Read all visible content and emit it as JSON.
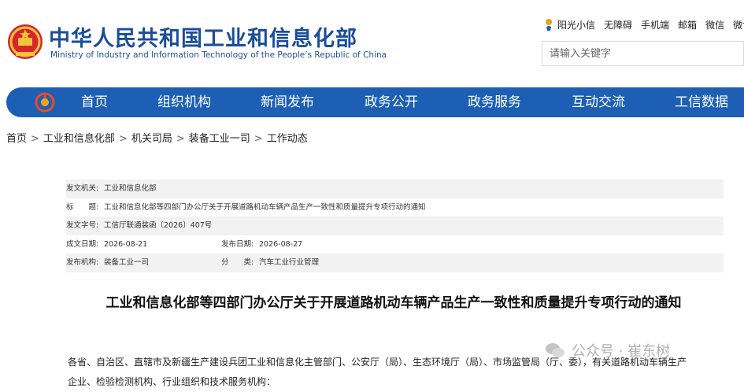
{
  "header": {
    "title_cn": "中华人民共和国工业和信息化部",
    "title_en": "Ministry of Industry and Information Technology of the People’s Republic of China",
    "top_links": [
      "阳光小信",
      "无障碍",
      "手机端",
      "邮箱",
      "微信",
      "微博"
    ],
    "search_placeholder": "请输入关键字"
  },
  "nav": {
    "items": [
      "首页",
      "组织机构",
      "新闻发布",
      "政务公开",
      "政务服务",
      "互动交流",
      "工信数据"
    ],
    "bar_color": "#1c5fb5"
  },
  "breadcrumb": [
    "首页",
    "工业和信息化部",
    "机关司局",
    "装备工业一司",
    "工作动态"
  ],
  "meta": {
    "issuer_label": "发文机关:",
    "issuer": "工业和信息化部",
    "title_label": "标　　题:",
    "title": "工业和信息化部等四部门办公厅关于开展道路机动车辆产品生产一致性和质量提升专项行动的通知",
    "docno_label": "发文字号:",
    "docno": "工信厅联通装函〔2026〕407号",
    "written_label": "成文日期:",
    "written": "2026-08-21",
    "published_label": "发布日期:",
    "published": "2026-08-27",
    "org_label": "发布机构:",
    "org": "装备工业一司",
    "category_label": "分　　类:",
    "category": "汽车工业行业管理"
  },
  "article": {
    "title": "工业和信息化部等四部门办公厅关于开展道路机动车辆产品生产一致性和质量提升专项行动的通知",
    "line1": "各省、自治区、直辖市及新疆生产建设兵团工业和信息化主管部门、公安厅（局）、生态环境厅（局）、市场监管局（厅、委），有关道路机动车辆生产",
    "line2": "企业、检验检测机构、行业组织和技术服务机构："
  },
  "watermark": "公众号 · 崔东树"
}
